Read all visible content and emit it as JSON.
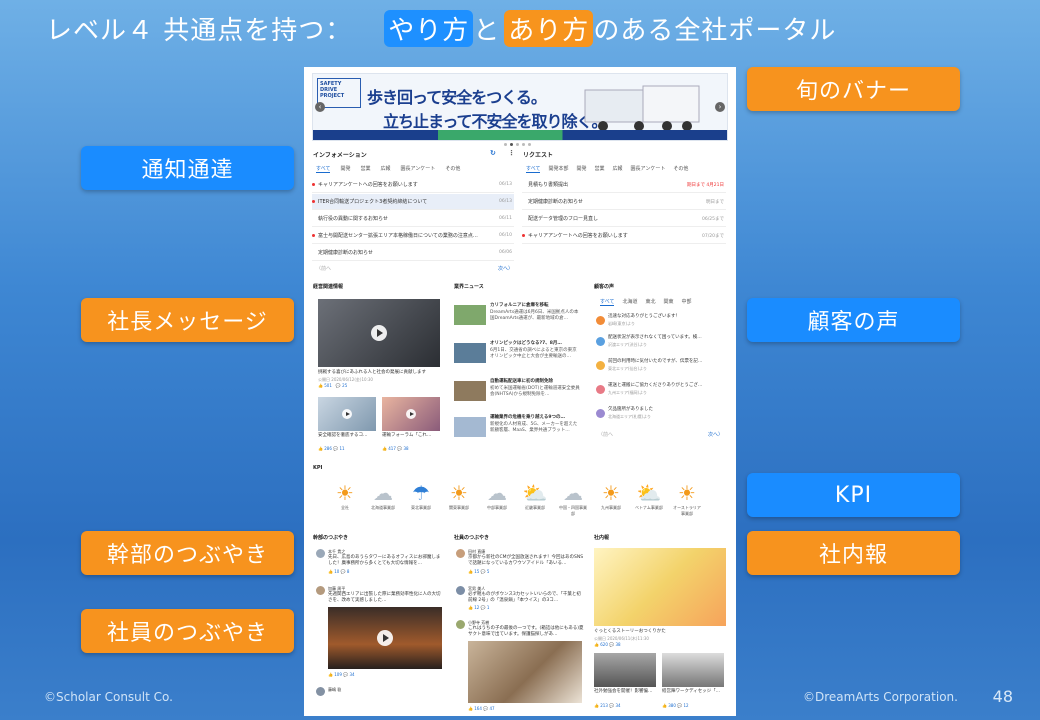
{
  "title": {
    "prefix": "レベル４ 共通点を持つ：",
    "hl1": "やり方",
    "mid": "と",
    "hl2": "あり方",
    "suffix": "のある全社ポータル"
  },
  "labels": {
    "tsuchi": "通知通達",
    "shacho": "社長メッセージ",
    "kanbu": "幹部のつぶやき",
    "shain": "社員のつぶやき",
    "shun": "旬のバナー",
    "kokyaku": "顧客の声",
    "kpi": "KPI",
    "shanaiho": "社内報"
  },
  "footer": {
    "left": "©Scholar Consult Co.",
    "right": "©DreamArts Corporation.",
    "page": "48"
  },
  "colors": {
    "orange": "#f7931e",
    "blue": "#1a8cff"
  },
  "portal": {
    "banner": {
      "logo": "SAFETY DRIVE PROJECT",
      "line1": "歩き回って安全をつくる。",
      "line2": "立ち止まって不安全を取り除く。"
    },
    "info": {
      "title": "インフォメーション",
      "tabs": [
        "すべて",
        "開発",
        "営業",
        "広報",
        "園長アンケート",
        "その他"
      ],
      "rows": [
        {
          "text": "キャリアアンケートへの回答をお願いします",
          "date": "06/13",
          "dot": true
        },
        {
          "text": "ITER合同輸送プロジェクト3者契約締結について",
          "date": "06/13",
          "dot": true
        },
        {
          "text": "執行役の異動に関するお知らせ",
          "date": "06/11",
          "dot": false
        },
        {
          "text": "富士与開配送センター拡張エリア本格稼働日についての業務の注意点…",
          "date": "06/10",
          "dot": true
        },
        {
          "text": "定期健康診断のお知らせ",
          "date": "06/06",
          "dot": false
        }
      ],
      "prev": "〈前へ",
      "next": "次へ〉"
    },
    "request": {
      "title": "リクエスト",
      "tabs": [
        "すべて",
        "開発本部",
        "開発",
        "営業",
        "広報",
        "園長アンケート",
        "その他"
      ],
      "rows": [
        {
          "text": "見積もり書類提出",
          "date": "期日まで 4月21日"
        },
        {
          "text": "定期健康診断のお知らせ",
          "date": "明日まで"
        },
        {
          "text": "配送データ管理のフロー見直し",
          "date": "06/25まで"
        },
        {
          "text": "キャリアアンケートへの回答をお願いします",
          "date": "07/20まで"
        }
      ]
    },
    "exec": {
      "title": "経営関連情報",
      "main_caption": "挑戦する喜びにあふれる人と社会の発展に貢献します",
      "main_meta": "公開日 2020/06/12(金)10:30",
      "main_likes": "501",
      "main_comments": "25",
      "sub1_caption": "安全確認を徹底するコ…",
      "sub1_likes": "286",
      "sub1_comments": "11",
      "sub2_caption": "運輸フォーラム「これ…",
      "sub2_likes": "417",
      "sub2_comments": "38"
    },
    "news": {
      "title": "業界ニュース",
      "items": [
        {
          "head": "カリフォルニアに倉庫を移転",
          "body": "DreamArts通運は6月6日、米国拠点人の本国DreamArts通運が、最新地域の倉…"
        },
        {
          "head": "オリンピックはどうなる?7、8月…",
          "body": "6月1日、交通省の調べによると東京の東京オリンピック中止と大会が主要輸送の…"
        },
        {
          "head": "自動運転配送車に初の規制免除",
          "body": "初めて米国運輸省(DOT)と運輸道運安全委員会(NHTSA)から規制免除を…"
        },
        {
          "head": "運輸業界の危機を乗り越える9つの…",
          "body": "新規化の人材育成、5G、メーカーを超えた新顧客層、MaaS、業界共通プラット…"
        }
      ]
    },
    "voice": {
      "title": "顧客の声",
      "tabs": [
        "すべて",
        "北海道",
        "東北",
        "関東",
        "中部"
      ],
      "items": [
        {
          "text": "迅速な対応ありがとうございます！",
          "sub": "岩崎(東京)より",
          "time": "たった今"
        },
        {
          "text": "配送状況が表示されなくて困っています。検…",
          "sub": "沢渡エリア(渋谷)より",
          "time": "3時間前"
        },
        {
          "text": "前回の利用時に気付いたのですが、伝票を記…",
          "sub": "東北エリア(仙台)より",
          "time": "5時間前"
        },
        {
          "text": "運送と運搬にご協力くださりありがとうござ…",
          "sub": "九州エリア(福岡)より",
          "time": "5時間前"
        },
        {
          "text": "欠品箇所がありました",
          "sub": "北海道エリア(札幌)より",
          "time": "6時間前"
        }
      ],
      "prev": "〈前へ",
      "next": "次へ〉"
    },
    "kpi": {
      "title": "KPI",
      "items": [
        {
          "name": "全社",
          "icon": "sunny-icon"
        },
        {
          "name": "北海道事業部",
          "icon": "cloudy-icon"
        },
        {
          "name": "東北事業部",
          "icon": "umbrella-icon"
        },
        {
          "name": "関東事業部",
          "icon": "sunny-icon"
        },
        {
          "name": "中部事業部",
          "icon": "cloudy-icon"
        },
        {
          "name": "近畿事業部",
          "icon": "partly-sunny-icon"
        },
        {
          "name": "中国・四国事業部",
          "icon": "cloudy-icon"
        },
        {
          "name": "九州事業部",
          "icon": "sunny-icon"
        },
        {
          "name": "ベトナム事業部",
          "icon": "partly-sunny-icon"
        },
        {
          "name": "オーストラリア事業部",
          "icon": "sunny-icon"
        }
      ]
    },
    "exec_tweets": {
      "title": "幹部のつぶやき",
      "t1_user": "本千 貴之",
      "t1_text": "先日、広島のあうらタワーにあるオフィスにお邪魔しました！廣事務所から多くとても大切な情報を…",
      "t1_likes": "10",
      "t1_comments": "8",
      "t2_user": "加藤 周平",
      "t2_text": "先週関西エリアに出張した際に業務効率性化に人の大切さを、改めて実感しました…",
      "t2_likes": "109",
      "t2_comments": "34",
      "t3_user": "藤嶋 稔"
    },
    "staff_tweets": {
      "title": "社員のつぶやき",
      "t1_user": "田村 直康",
      "t1_text": "京都から新社のCMが全国放送されます！今回はあのSNSで話題になっているカワウソアイドル「あいる…",
      "t1_likes": "15",
      "t1_comments": "5",
      "t2_user": "宮男 美人",
      "t2_text": "必ず靴ものがボウンス3カセットいいらので、「千葉と初前線 2号」の「温泉鍋」「本ウイス」の3コ…",
      "t2_likes": "12",
      "t2_comments": "1",
      "t3_user": "小野寺 芳樹",
      "t3_text": "これはうちの子の最後の一つです。(箱詰は他にもある)夏サクト意味で出ています。保護猫探しがあ…",
      "t3_likes": "164",
      "t3_comments": "47"
    },
    "newsletter": {
      "title": "社内報",
      "main_caption": "ぐっとくるストーリーおつくりかた",
      "main_meta": "公開日 2020/06/11(木)11:30",
      "main_likes": "620",
      "main_comments": "38",
      "sub1_caption": "社外勉強会を開催！影響偏…",
      "sub1_likes": "213",
      "sub1_comments": "34",
      "sub2_caption": "経営陣ワークディセッジ「…",
      "sub2_likes": "380",
      "sub2_comments": "12"
    }
  }
}
